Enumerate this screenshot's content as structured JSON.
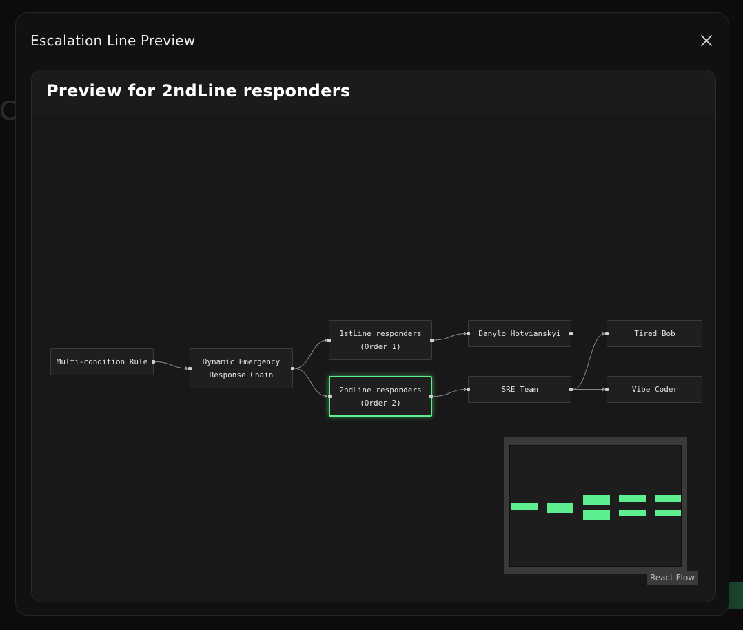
{
  "modal": {
    "title": "Escalation Line Preview",
    "close_icon": "close-icon"
  },
  "panel": {
    "title": "Preview for 2ndLine responders"
  },
  "flow": {
    "nodes": [
      {
        "id": "rule",
        "label": "Multi-condition Rule",
        "selected": false
      },
      {
        "id": "chain",
        "label": "Dynamic Emergency\nResponse Chain",
        "selected": false
      },
      {
        "id": "first",
        "label": "1stLine responders\n(Order 1)",
        "selected": false
      },
      {
        "id": "second",
        "label": "2ndLine responders\n(Order 2)",
        "selected": true
      },
      {
        "id": "danylo",
        "label": "Danylo Hotvianskyi",
        "selected": false
      },
      {
        "id": "sre",
        "label": "SRE Team",
        "selected": false
      },
      {
        "id": "bob",
        "label": "Tired Bob",
        "selected": false
      },
      {
        "id": "vibe",
        "label": "Vibe Coder",
        "selected": false
      }
    ],
    "edges": [
      [
        "rule",
        "chain"
      ],
      [
        "chain",
        "first"
      ],
      [
        "chain",
        "second"
      ],
      [
        "first",
        "danylo"
      ],
      [
        "second",
        "sre"
      ],
      [
        "sre",
        "bob"
      ],
      [
        "sre",
        "vibe"
      ]
    ]
  },
  "minimap": {
    "node_color": "#5dee8f",
    "attribution": "React Flow"
  },
  "colors": {
    "accent": "#5dee8f",
    "background": "#111111"
  }
}
